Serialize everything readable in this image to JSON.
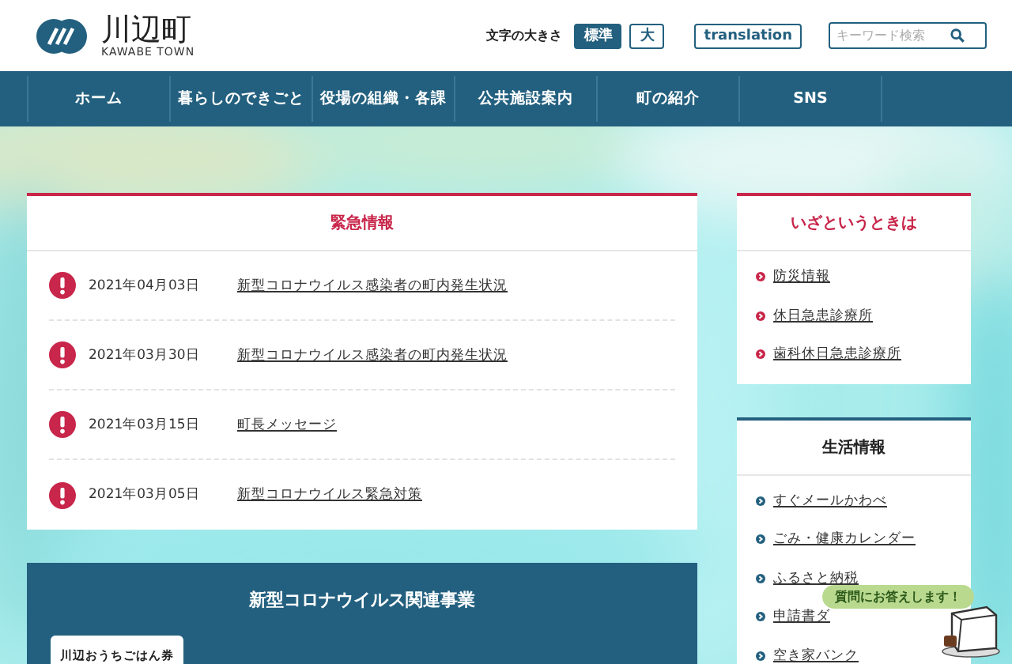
{
  "header": {
    "logo_title": "川辺町",
    "logo_subtitle": "KAWABE TOWN",
    "font_size_label": "文字の大きさ",
    "font_sizes": [
      {
        "label": "標準",
        "selected": true
      },
      {
        "label": "大",
        "selected": false
      }
    ],
    "translation_button": "translation",
    "search": {
      "placeholder": "キーワード検索"
    }
  },
  "nav": [
    "ホーム",
    "暮らしのできごと",
    "役場の組織・各課",
    "公共施設案内",
    "町の紹介",
    "SNS"
  ],
  "emergency": {
    "title": "緊急情報",
    "items": [
      {
        "date": "2021年04月03日",
        "title": "新型コロナウイルス感染者の町内発生状況"
      },
      {
        "date": "2021年03月30日",
        "title": "新型コロナウイルス感染者の町内発生状況"
      },
      {
        "date": "2021年03月15日",
        "title": "町長メッセージ"
      },
      {
        "date": "2021年03月05日",
        "title": "新型コロナウイルス緊急対策"
      }
    ]
  },
  "covid": {
    "title": "新型コロナウイルス関連事業",
    "tabs": [
      "川辺おうちごはん券"
    ]
  },
  "side_panels": [
    {
      "title": "いざというときは",
      "color": "#c8264a",
      "items": [
        "防災情報",
        "休日急患診療所",
        "歯科休日急患診療所"
      ]
    },
    {
      "title": "生活情報",
      "color": "#23607f",
      "items": [
        "すぐメールかわべ",
        "ごみ・健康カレンダー",
        "ふるさと納税",
        "申請書ダ",
        "空き家バンク"
      ]
    }
  ],
  "chat": {
    "bubble": "質問にお答えします！"
  }
}
